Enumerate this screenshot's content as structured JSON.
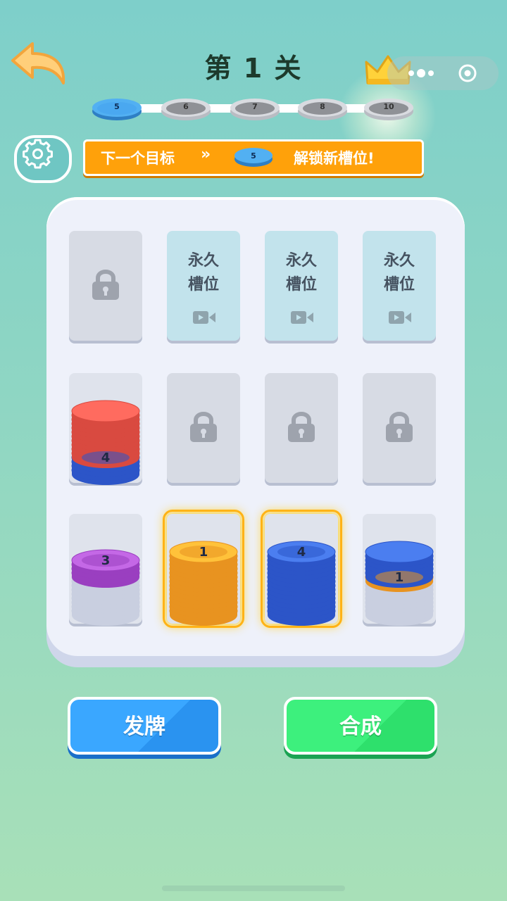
{
  "header": {
    "back_icon": "back-arrow-icon",
    "level_title": "第 1 关",
    "crown_icon": "crown-icon",
    "menu_icon": "more-dots-icon",
    "target_icon": "target-icon"
  },
  "progress": {
    "nodes": [
      {
        "label": "5",
        "state": "current",
        "color": "#4aa8f0"
      },
      {
        "label": "6",
        "state": "locked",
        "color": "#8a8a8a"
      },
      {
        "label": "7",
        "state": "locked",
        "color": "#8a8a8a"
      },
      {
        "label": "8",
        "state": "locked",
        "color": "#8a8a8a"
      },
      {
        "label": "10",
        "state": "locked",
        "color": "#8a8a8a"
      }
    ]
  },
  "settings": {
    "icon": "gear-icon"
  },
  "goal": {
    "prefix": "下一个目标",
    "chevrons": "»",
    "chip_label": "5",
    "suffix": "解锁新槽位!"
  },
  "board": {
    "permanent_slot_line1": "永久",
    "permanent_slot_line2": "槽位",
    "slots": [
      {
        "row": 0,
        "col": 0,
        "type": "locked"
      },
      {
        "row": 0,
        "col": 1,
        "type": "permanent"
      },
      {
        "row": 0,
        "col": 2,
        "type": "permanent"
      },
      {
        "row": 0,
        "col": 3,
        "type": "permanent"
      },
      {
        "row": 1,
        "col": 0,
        "type": "stack",
        "highlight": false,
        "layers": [
          {
            "color": "blue",
            "count": 4,
            "label": "4"
          },
          {
            "color": "red",
            "count": 11
          }
        ]
      },
      {
        "row": 1,
        "col": 1,
        "type": "locked"
      },
      {
        "row": 1,
        "col": 2,
        "type": "locked"
      },
      {
        "row": 1,
        "col": 3,
        "type": "locked"
      },
      {
        "row": 2,
        "col": 0,
        "type": "stack",
        "highlight": false,
        "layers": [
          {
            "color": "white",
            "count": 9
          },
          {
            "color": "purple",
            "count": 4,
            "label": "3"
          }
        ]
      },
      {
        "row": 2,
        "col": 1,
        "type": "stack",
        "highlight": true,
        "layers": [
          {
            "color": "yellow",
            "count": 15,
            "label": "1"
          }
        ]
      },
      {
        "row": 2,
        "col": 2,
        "type": "stack",
        "highlight": true,
        "layers": [
          {
            "color": "blue",
            "count": 15,
            "label": "4"
          }
        ]
      },
      {
        "row": 2,
        "col": 3,
        "type": "stack",
        "highlight": false,
        "layers": [
          {
            "color": "white",
            "count": 8
          },
          {
            "color": "yellow",
            "count": 1,
            "label": "1"
          },
          {
            "color": "blue",
            "count": 6
          }
        ]
      }
    ],
    "coin_colors": {
      "red": [
        "#ff6b5f",
        "#d94a40"
      ],
      "blue": [
        "#4b7ef0",
        "#2c55c8"
      ],
      "purple": [
        "#c468e6",
        "#9a3fc0"
      ],
      "yellow": [
        "#ffc23a",
        "#e89320"
      ],
      "white": [
        "#f6f8ff",
        "#c9cfe0"
      ]
    }
  },
  "buttons": {
    "deal": "发牌",
    "merge": "合成"
  }
}
